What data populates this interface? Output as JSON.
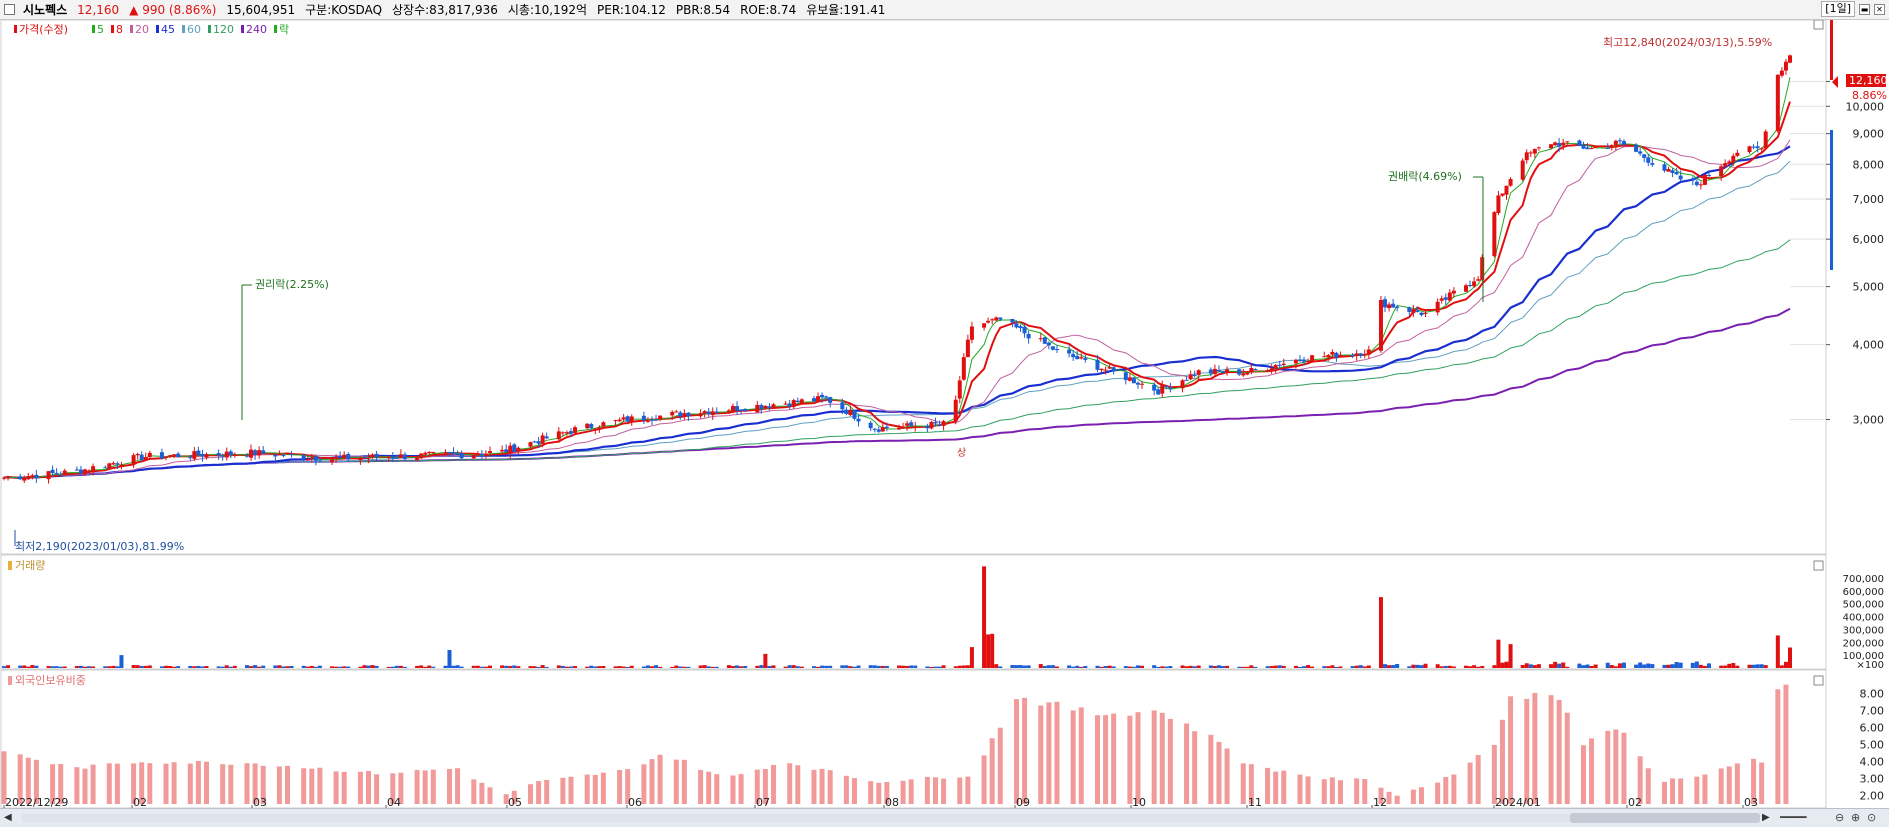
{
  "header": {
    "stock_name": "시노펙스",
    "price": "12,160",
    "change": "▲  990  (8.86%)",
    "volume": "15,604,951",
    "market": "구분:KOSDAQ",
    "listed": "상장수:83,817,936",
    "cap": "시총:10,192억",
    "per": "PER:104.12",
    "pbr": "PBR:8.54",
    "roe": "ROE:8.74",
    "float": "유보율:191.41",
    "period": "[1일]"
  },
  "colors": {
    "up": "#e01010",
    "down": "#1a5fd6",
    "ma5": "#22aa22",
    "ma8": "#e01010",
    "ma20": "#c060a0",
    "ma45": "#1a2fd0",
    "ma60": "#60a0c0",
    "ma120": "#30a060",
    "ma240": "#7a1fb0",
    "foreign_bar": "#f29a9a"
  },
  "price_panel": {
    "legend": [
      {
        "label": "가격(수정)",
        "color": "#e01010"
      },
      {
        "label": "5",
        "color": "#22aa22"
      },
      {
        "label": "8",
        "color": "#e01010"
      },
      {
        "label": "20",
        "color": "#c060a0"
      },
      {
        "label": "45",
        "color": "#1a2fd0"
      },
      {
        "label": "60",
        "color": "#60a0c0"
      },
      {
        "label": "120",
        "color": "#30a060"
      },
      {
        "label": "240",
        "color": "#7a1fb0"
      },
      {
        "label": "락",
        "color": "#22aa22"
      }
    ],
    "high_note": "최고12,840(2024/03/13),5.59%",
    "low_note": "최저2,190(2023/01/03),81.99%",
    "event1": "권리락(2.25%)",
    "event2": "권배락(4.69%)",
    "sang_mark": "상",
    "last_price_tag": "12,160",
    "last_pct": "8.86%",
    "y_ticks": [
      "11,000",
      "10,000",
      "9,000",
      "8,000",
      "7,000",
      "6,000",
      "5,000",
      "4,000",
      "3,000"
    ]
  },
  "volume_panel": {
    "title": "거래량",
    "y_ticks": [
      "700,000",
      "600,000",
      "500,000",
      "400,000",
      "300,000",
      "200,000",
      "100,000",
      "×100"
    ]
  },
  "foreign_panel": {
    "title": "외국인보유비중",
    "y_ticks": [
      "8.00",
      "7.00",
      "6.00",
      "5.00",
      "4.00",
      "3.00",
      "2.00"
    ]
  },
  "x_axis": [
    "2022/12/29",
    "02",
    "03",
    "04",
    "05",
    "06",
    "07",
    "08",
    "09",
    "10",
    "11",
    "12",
    "2024/01",
    "02",
    "03"
  ],
  "chart_data": {
    "type": "candlestick",
    "x_start": "2022/12/29",
    "x_end": "2024/03/14",
    "ylim": [
      2000,
      12900
    ],
    "y_scale": "log",
    "price_anchors": [
      [
        "2022/12/29",
        2400
      ],
      [
        "2023/01/15",
        2450
      ],
      [
        "2023/02/01",
        2600
      ],
      [
        "2023/02/15",
        2620
      ],
      [
        "2023/03/01",
        2640
      ],
      [
        "2023/03/20",
        2580
      ],
      [
        "2023/04/01",
        2600
      ],
      [
        "2023/04/20",
        2620
      ],
      [
        "2023/05/01",
        2650
      ],
      [
        "2023/05/20",
        2900
      ],
      [
        "2023/06/01",
        3000
      ],
      [
        "2023/06/20",
        3100
      ],
      [
        "2023/07/01",
        3150
      ],
      [
        "2023/07/20",
        3250
      ],
      [
        "2023/08/01",
        2900
      ],
      [
        "2023/08/20",
        2950
      ],
      [
        "2023/08/25",
        4300
      ],
      [
        "2023/09/01",
        4400
      ],
      [
        "2023/09/15",
        3900
      ],
      [
        "2023/10/01",
        3550
      ],
      [
        "2023/10/10",
        3350
      ],
      [
        "2023/10/20",
        3600
      ],
      [
        "2023/11/01",
        3600
      ],
      [
        "2023/11/15",
        3800
      ],
      [
        "2023/12/01",
        3900
      ],
      [
        "2023/12/04",
        4700
      ],
      [
        "2023/12/15",
        4500
      ],
      [
        "2023/12/28",
        5200
      ],
      [
        "2024/01/02",
        7000
      ],
      [
        "2024/01/08",
        8200
      ],
      [
        "2024/01/15",
        8700
      ],
      [
        "2024/01/25",
        8500
      ],
      [
        "2024/02/01",
        8700
      ],
      [
        "2024/02/15",
        7600
      ],
      [
        "2024/02/20",
        7400
      ],
      [
        "2024/03/01",
        8400
      ],
      [
        "2024/03/07",
        8500
      ],
      [
        "2024/03/11",
        11300
      ],
      [
        "2024/03/14",
        12160
      ]
    ],
    "volume_spikes": [
      [
        "2023/01/27",
        100000
      ],
      [
        "2023/04/18",
        140000
      ],
      [
        "2023/07/05",
        110000
      ],
      [
        "2023/08/25",
        160000
      ],
      [
        "2023/08/28",
        780000
      ],
      [
        "2023/08/29",
        260000
      ],
      [
        "2023/08/30",
        260000
      ],
      [
        "2023/12/04",
        540000
      ],
      [
        "2024/01/02",
        220000
      ],
      [
        "2024/01/05",
        170000
      ],
      [
        "2024/03/11",
        240000
      ],
      [
        "2024/03/14",
        150000
      ]
    ],
    "foreign_anchors": [
      [
        "2022/12/29",
        4.6
      ],
      [
        "2023/01/15",
        3.6
      ],
      [
        "2023/02/01",
        4.0
      ],
      [
        "2023/03/01",
        3.9
      ],
      [
        "2023/04/01",
        3.3
      ],
      [
        "2023/04/20",
        3.6
      ],
      [
        "2023/05/01",
        2.0
      ],
      [
        "2023/05/10",
        2.8
      ],
      [
        "2023/06/01",
        3.5
      ],
      [
        "2023/06/10",
        4.5
      ],
      [
        "2023/06/25",
        3.0
      ],
      [
        "2023/07/10",
        4.0
      ],
      [
        "2023/08/01",
        2.8
      ],
      [
        "2023/08/25",
        3.2
      ],
      [
        "2023/09/05",
        7.8
      ],
      [
        "2023/09/25",
        6.8
      ],
      [
        "2023/10/10",
        7.0
      ],
      [
        "2023/10/25",
        5.2
      ],
      [
        "2023/11/01",
        3.8
      ],
      [
        "2023/11/20",
        3.0
      ],
      [
        "2023/12/01",
        2.9
      ],
      [
        "2023/12/08",
        2.0
      ],
      [
        "2023/12/20",
        3.0
      ],
      [
        "2024/01/01",
        5.0
      ],
      [
        "2024/01/05",
        8.0
      ],
      [
        "2024/01/18",
        7.7
      ],
      [
        "2024/01/22",
        5.0
      ],
      [
        "2024/02/01",
        6.1
      ],
      [
        "2024/02/10",
        2.8
      ],
      [
        "2024/02/25",
        3.4
      ],
      [
        "2024/03/05",
        4.2
      ],
      [
        "2024/03/08",
        3.8
      ],
      [
        "2024/03/10",
        8.3
      ],
      [
        "2024/03/14",
        8.4
      ]
    ]
  }
}
